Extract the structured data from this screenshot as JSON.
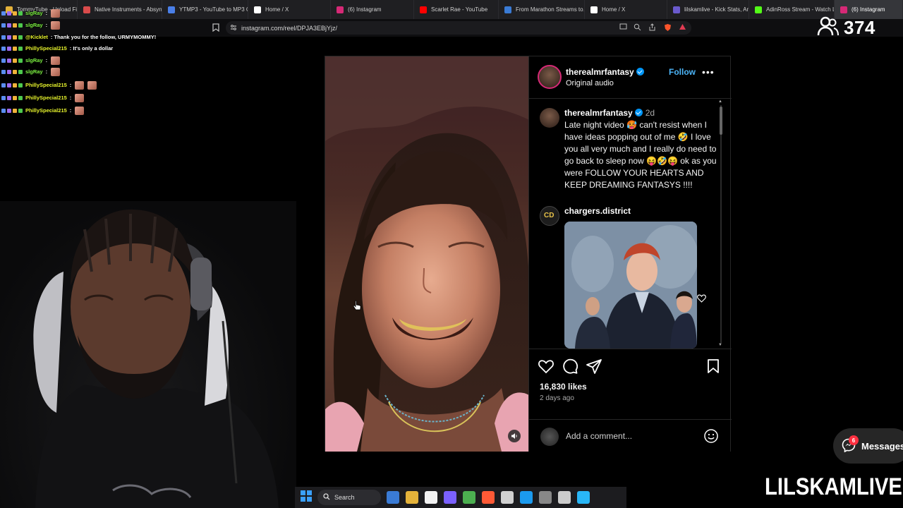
{
  "browser": {
    "tabs": [
      {
        "label": "TommyTube - Upload Files",
        "icon": "file-icon",
        "color": "#e4b23a"
      },
      {
        "label": "Native Instruments - Absynth",
        "icon": "app-icon",
        "color": "#d94b4b"
      },
      {
        "label": "YTMP3 - YouTube to MP3 Converter",
        "icon": "download-icon",
        "color": "#4a7fe8"
      },
      {
        "label": "Home / X",
        "icon": "x-logo-icon",
        "color": "#ffffff"
      },
      {
        "label": "(6) Instagram",
        "icon": "instagram-icon",
        "color": "#d62976"
      },
      {
        "label": "Scarlet Rae - YouTube",
        "icon": "youtube-icon",
        "color": "#ff0000"
      },
      {
        "label": "From Marathon Streams to…",
        "icon": "article-icon",
        "color": "#3a7bd5"
      },
      {
        "label": "Home / X",
        "icon": "x-logo-icon",
        "color": "#ffffff"
      },
      {
        "label": "lilskamlive - Kick Stats, Analytics",
        "icon": "stats-icon",
        "color": "#6a5acd"
      },
      {
        "label": "AdinRoss Stream - Watch Live",
        "icon": "kick-icon",
        "color": "#53fc18"
      },
      {
        "label": "(6) Instagram",
        "icon": "instagram-icon",
        "color": "#d62976"
      }
    ],
    "active_tab_index": 10,
    "url": "instagram.com/reel/DPJA3EBjYjz/"
  },
  "chat": [
    {
      "user": "slgRay",
      "message": ":",
      "emotes": 1,
      "color": "#7ef542"
    },
    {
      "user": "slgRay",
      "message": ":",
      "emotes": 1,
      "color": "#7ef542"
    },
    {
      "user": "@Kicklet",
      "message": ": Thank you for the follow, URMYMOMMY!",
      "emotes": 0,
      "color": "#e8f52c"
    },
    {
      "user": "PhillySpecial215",
      "message": ": It's only a dollar",
      "emotes": 0,
      "color": "#e8f52c"
    },
    {
      "user": "slgRay",
      "message": ":",
      "emotes": 1,
      "color": "#7ef542"
    },
    {
      "user": "slgRay",
      "message": ":",
      "emotes": 1,
      "color": "#7ef542"
    },
    {
      "user": "PhillySpecial215",
      "message": ":",
      "emotes": 2,
      "color": "#e8f52c"
    },
    {
      "user": "PhillySpecial215",
      "message": ":",
      "emotes": 1,
      "color": "#e8f52c"
    },
    {
      "user": "PhillySpecial215",
      "message": ":",
      "emotes": 1,
      "color": "#e8f52c"
    }
  ],
  "viewer_count": "374",
  "post": {
    "username": "therealmrfantasy",
    "audio": "Original audio",
    "follow_label": "Follow",
    "more_label": "•••",
    "caption_user": "therealmrfantasy",
    "caption_time": "2d",
    "caption": "Late night video 🥵 can't resist when I have ideas popping out of me 🤣 I love you all very much and I really do need to go back to sleep now 😝🤣😝 ok as you were FOLLOW YOUR HEARTS AND KEEP DREAMING FANTASYS !!!!",
    "comment_user": "chargers.district",
    "likes": "16,830 likes",
    "time_ago": "2 days ago",
    "comment_placeholder": "Add a comment..."
  },
  "taskbar": {
    "search_label": "Search",
    "apps": [
      "#3a7bd5",
      "#e4b23a",
      "#f2f2f2",
      "#7b61ff",
      "#4caf50",
      "#ff5a36",
      "#d0d0d0",
      "#1b9aee",
      "#888888",
      "#cccccc",
      "#29b6f6"
    ]
  },
  "messages": {
    "label": "Messages",
    "badge": "6"
  },
  "watermark": "LILSKAMLIVE"
}
